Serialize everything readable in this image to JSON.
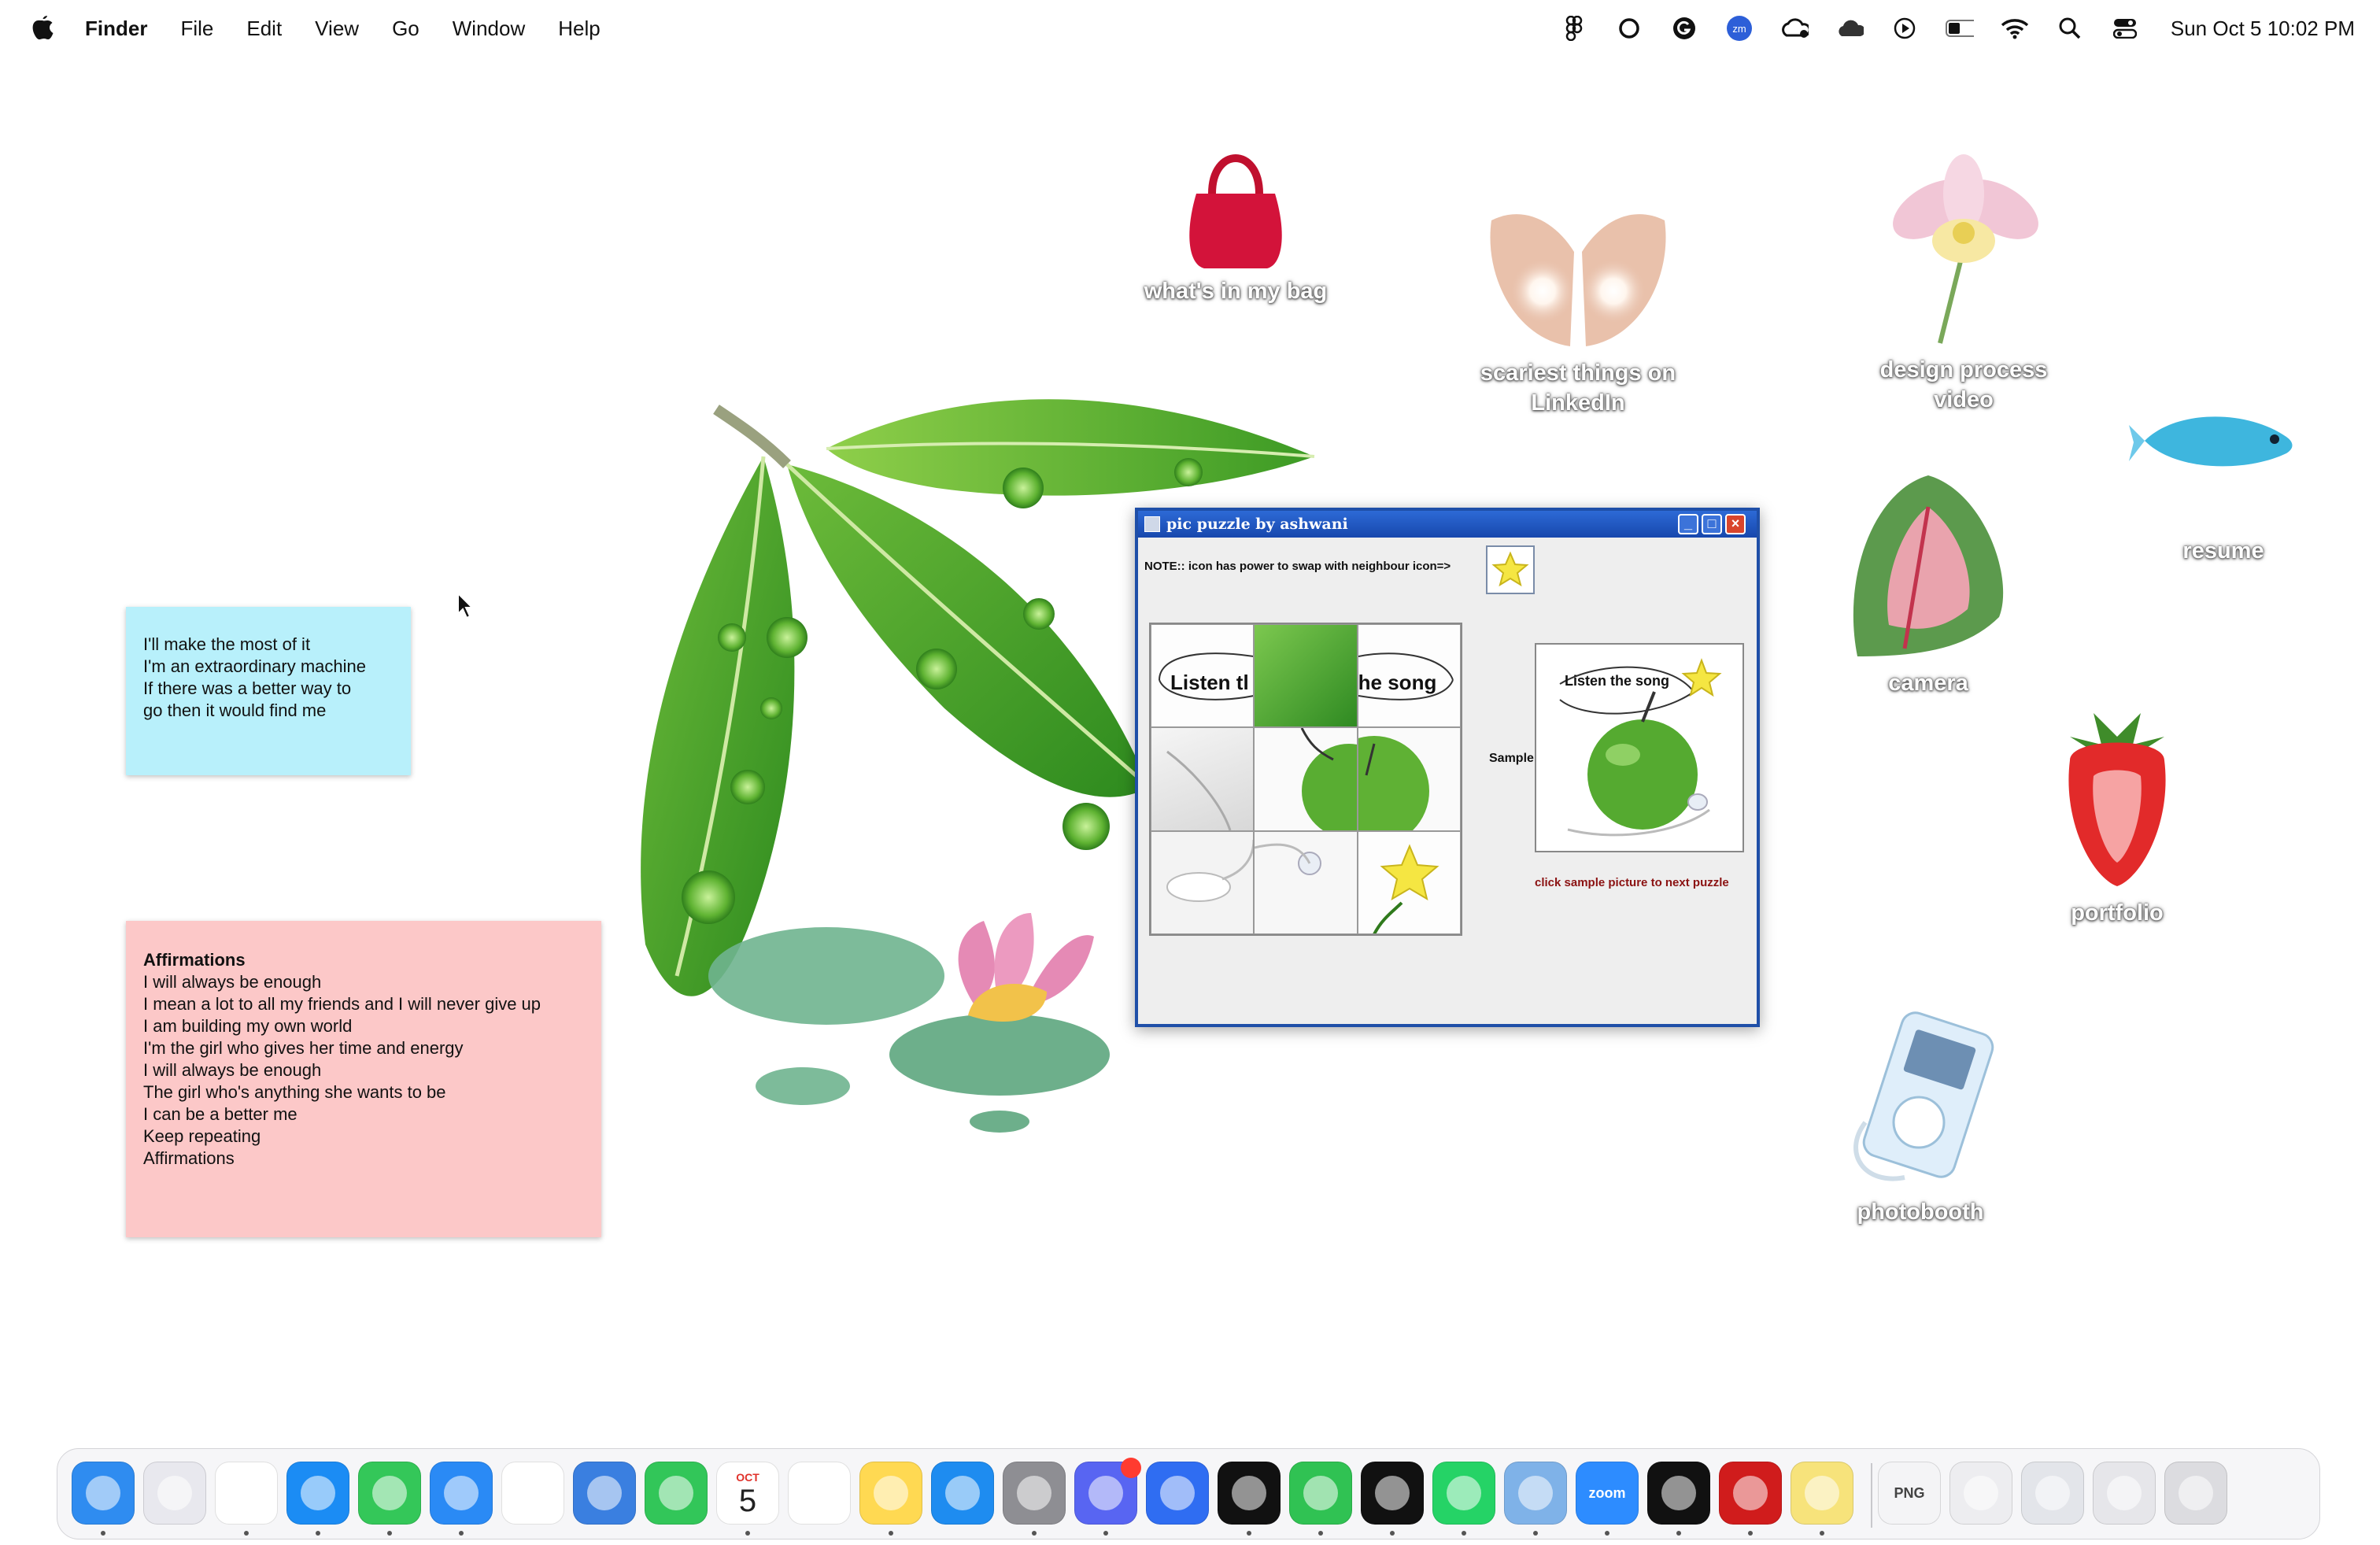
{
  "menubar": {
    "app_name": "Finder",
    "items": [
      "File",
      "Edit",
      "View",
      "Go",
      "Window",
      "Help"
    ],
    "clock": "Sun Oct 5  10:02 PM",
    "status_icons": [
      "figma-icon",
      "circle-icon",
      "grammarly-icon",
      "zoom-icon",
      "creative-cloud-icon",
      "icloud-icon",
      "play-icon",
      "battery-icon",
      "wifi-icon",
      "search-icon",
      "control-center-icon"
    ]
  },
  "desktop": {
    "icons": [
      {
        "label": "what's in my bag"
      },
      {
        "label": "scariest things on LinkedIn"
      },
      {
        "label": "design process video"
      },
      {
        "label": "resume"
      },
      {
        "label": "camera"
      },
      {
        "label": "portfolio"
      },
      {
        "label": "photobooth"
      }
    ]
  },
  "sticky_blue": {
    "lines": [
      "I'll make the most of it",
      "I'm an extraordinary machine",
      "If there was a better way to",
      "go then it would find me"
    ],
    "color": "#b8f0fb"
  },
  "sticky_pink": {
    "title": "Affirmations",
    "lines": [
      "I will always be enough",
      "I mean a lot to all my friends and I will never give up",
      "I am building my own world",
      "I'm the girl who gives her time and energy",
      "I will always be enough",
      "The girl who's anything she wants to be",
      "I can be a better me",
      "Keep repeating",
      "Affirmations"
    ],
    "color": "#fcc8c8"
  },
  "puzzle_window": {
    "title": "pic puzzle by ashwani",
    "note": "NOTE:: icon has power to swap with neighbour icon=>",
    "tile_texts": [
      "Listen tl",
      "",
      "he song",
      "",
      "",
      "",
      "",
      "",
      ""
    ],
    "sample_label": "Sample:",
    "sample_caption": "Listen the song",
    "next_hint": "click sample picture to next puzzle"
  },
  "dock": {
    "apps": [
      {
        "name": "finder",
        "color": "#2f8cf0",
        "running": true
      },
      {
        "name": "launchpad",
        "color": "#e8e8ee",
        "running": false
      },
      {
        "name": "chrome",
        "color": "#ffffff",
        "running": true
      },
      {
        "name": "safari",
        "color": "#1b8cf4",
        "running": true
      },
      {
        "name": "messages",
        "color": "#34c759",
        "running": true
      },
      {
        "name": "mail",
        "color": "#2a8af5",
        "running": true
      },
      {
        "name": "photos",
        "color": "#ffffff",
        "running": false
      },
      {
        "name": "weather",
        "color": "#3a7fe0",
        "running": false
      },
      {
        "name": "facetime",
        "color": "#32c659",
        "running": false
      },
      {
        "name": "calendar",
        "color": "#ffffff",
        "running": true,
        "month": "OCT",
        "day": "5"
      },
      {
        "name": "reminders",
        "color": "#ffffff",
        "running": false
      },
      {
        "name": "notes",
        "color": "#ffd952",
        "running": true
      },
      {
        "name": "app-store",
        "color": "#1e8cf0",
        "running": false
      },
      {
        "name": "system-settings",
        "color": "#8e8e93",
        "running": true
      },
      {
        "name": "discord",
        "color": "#5865f2",
        "running": true,
        "badge": true
      },
      {
        "name": "roblox",
        "color": "#2f6df2",
        "running": false
      },
      {
        "name": "spotify",
        "color": "#111111",
        "running": true
      },
      {
        "name": "find-my",
        "color": "#30c253",
        "running": true
      },
      {
        "name": "figma",
        "color": "#111111",
        "running": true
      },
      {
        "name": "whatsapp",
        "color": "#25d366",
        "running": true
      },
      {
        "name": "preview",
        "color": "#7fb2e8",
        "running": true
      },
      {
        "name": "zoom",
        "color": "#2d8cff",
        "running": true,
        "label": "zoom"
      },
      {
        "name": "chatgpt",
        "color": "#111111",
        "running": true
      },
      {
        "name": "acrobat",
        "color": "#d01c1c",
        "running": true
      },
      {
        "name": "stickies",
        "color": "#f7e37b",
        "running": true
      },
      {
        "name": "png-file",
        "color": "#f4f4f6",
        "running": false,
        "label": "PNG"
      },
      {
        "name": "stack-documents",
        "color": "#ededf0",
        "running": false
      },
      {
        "name": "stack-screenshots",
        "color": "#e3e5ea",
        "running": false
      },
      {
        "name": "stack-downloads",
        "color": "#e6e6ea",
        "running": false
      },
      {
        "name": "trash",
        "color": "#dcdce0",
        "running": false
      }
    ]
  }
}
